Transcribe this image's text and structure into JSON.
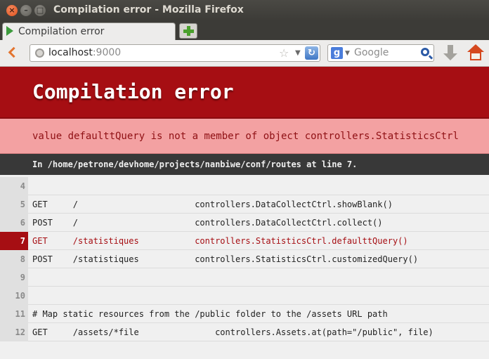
{
  "window": {
    "title": "Compilation error - Mozilla Firefox",
    "buttons": {
      "close": "×",
      "minimize": "–",
      "maximize": "□"
    }
  },
  "tabs": [
    {
      "label": "Compilation error",
      "icon": "play-triangle-icon",
      "active": true
    }
  ],
  "nav": {
    "url_host": "localhost",
    "url_port": ":9000",
    "search_placeholder": "Google",
    "search_engine_letter": "g"
  },
  "error": {
    "title": "Compilation error",
    "message": "value defaulttQuery is not a member of object controllers.StatisticsCtrl",
    "location": "In /home/petrone/devhome/projects/nanbiwe/conf/routes at line 7."
  },
  "source": [
    {
      "line": "4",
      "code": "",
      "error": false
    },
    {
      "line": "5",
      "code": "GET     /                       controllers.DataCollectCtrl.showBlank()",
      "error": false
    },
    {
      "line": "6",
      "code": "POST    /                       controllers.DataCollectCtrl.collect()",
      "error": false
    },
    {
      "line": "7",
      "code": "GET     /statistiques           controllers.StatisticsCtrl.defaulttQuery()",
      "error": true
    },
    {
      "line": "8",
      "code": "POST    /statistiques           controllers.StatisticsCtrl.customizedQuery()",
      "error": false
    },
    {
      "line": "9",
      "code": "",
      "error": false
    },
    {
      "line": "10",
      "code": "",
      "error": false
    },
    {
      "line": "11",
      "code": "# Map static resources from the /public folder to the /assets URL path",
      "error": false
    },
    {
      "line": "12",
      "code": "GET     /assets/*file               controllers.Assets.at(path=\"/public\", file)",
      "error": false
    }
  ],
  "colors": {
    "error_red": "#a60e13",
    "message_bg": "#f3a1a2",
    "file_bar_bg": "#383838"
  }
}
